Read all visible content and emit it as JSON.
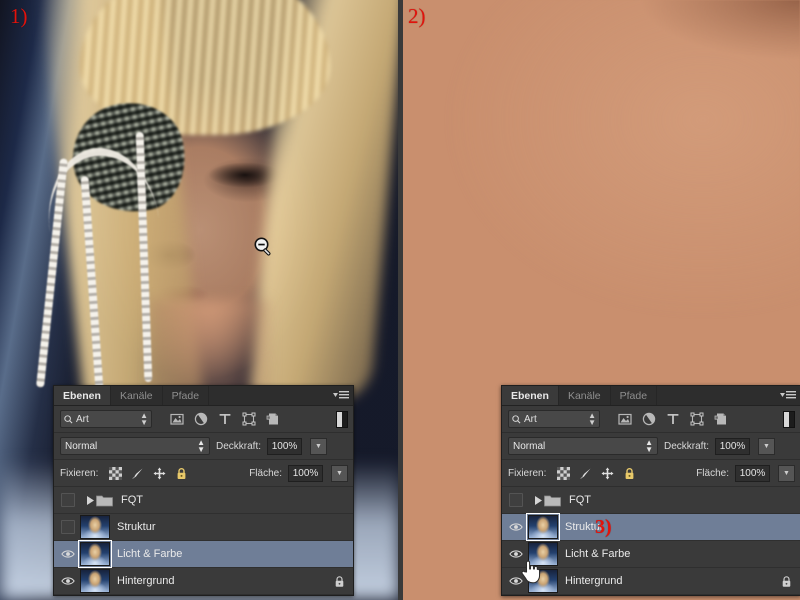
{
  "meta": {
    "app": "Adobe Photoshop",
    "locale": "de",
    "accent_marker_color": "#e3120b",
    "panel_background": "#3a3a3a",
    "selected_row_color": "#6f7e97"
  },
  "annotations": [
    {
      "id": "marker-1",
      "text": "1)"
    },
    {
      "id": "marker-2",
      "text": "2)"
    },
    {
      "id": "marker-3",
      "text": "3)"
    }
  ],
  "viewports": {
    "left": {
      "name": "portrait-full-view",
      "description": "Blonde woman portrait with checkered eyepatch and pearl strands",
      "cursor": "zoom-out-magnifier-icon"
    },
    "right": {
      "name": "skin-extreme-zoom-view",
      "description": "Extreme zoom on blurred skin with nostril shadow",
      "cursor": "pointing-hand-icon"
    }
  },
  "panel": {
    "tabs": [
      {
        "label": "Ebenen",
        "active": true
      },
      {
        "label": "Kanäle",
        "active": false
      },
      {
        "label": "Pfade",
        "active": false
      }
    ],
    "menu_icon": "panel-menu-icon",
    "filter": {
      "kind_label": "Art",
      "kind_icon": "search-icon",
      "icons": [
        "pixel-layer-filter-icon",
        "adjustment-layer-filter-icon",
        "type-layer-filter-icon",
        "shape-layer-filter-icon",
        "smart-object-filter-icon"
      ],
      "toggle_icon": "filter-toggle-switch"
    },
    "blend": {
      "mode": "Normal",
      "opacity_label": "Deckkraft:",
      "opacity_value": "100%"
    },
    "lock": {
      "label": "Fixieren:",
      "icons": [
        "lock-transparent-pixels-icon",
        "lock-image-pixels-icon",
        "lock-position-icon",
        "lock-all-icon"
      ],
      "fill_label": "Fläche:",
      "fill_value": "100%"
    }
  },
  "panel_left": {
    "title": "Ebenen",
    "layers": [
      {
        "name": "FQT",
        "type": "group",
        "visible": false,
        "selected": false,
        "locked": false,
        "thumb": "folder-icon"
      },
      {
        "name": "Struktur",
        "type": "pixel",
        "visible": false,
        "selected": false,
        "locked": false,
        "thumb": "layer-thumbnail"
      },
      {
        "name": "Licht & Farbe",
        "type": "pixel",
        "visible": true,
        "selected": true,
        "locked": false,
        "thumb": "layer-thumbnail"
      },
      {
        "name": "Hintergrund",
        "type": "pixel",
        "visible": true,
        "selected": false,
        "locked": true,
        "thumb": "layer-thumbnail"
      }
    ]
  },
  "panel_right": {
    "title": "Ebenen",
    "layers": [
      {
        "name": "FQT",
        "type": "group",
        "visible": false,
        "selected": false,
        "locked": false,
        "thumb": "folder-icon"
      },
      {
        "name": "Struktur",
        "type": "pixel",
        "visible": true,
        "selected": true,
        "locked": false,
        "thumb": "layer-thumbnail"
      },
      {
        "name": "Licht & Farbe",
        "type": "pixel",
        "visible": true,
        "selected": false,
        "locked": false,
        "thumb": "layer-thumbnail"
      },
      {
        "name": "Hintergrund",
        "type": "pixel",
        "visible": true,
        "selected": false,
        "locked": true,
        "thumb": "layer-thumbnail"
      }
    ]
  }
}
